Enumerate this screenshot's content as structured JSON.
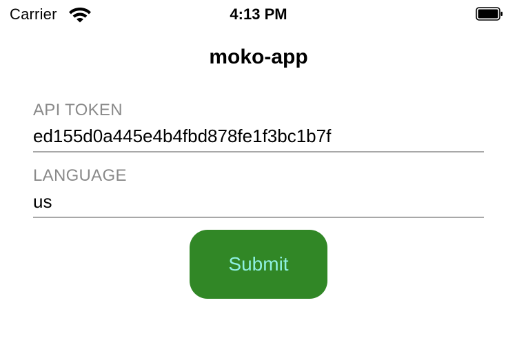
{
  "status_bar": {
    "carrier": "Carrier",
    "time": "4:13 PM",
    "wifi_icon": "wifi-icon",
    "battery_icon": "battery-icon"
  },
  "nav": {
    "title": "moko-app"
  },
  "form": {
    "api_token": {
      "label": "API TOKEN",
      "value": "ed155d0a445e4b4fbd878fe1f3bc1b7f"
    },
    "language": {
      "label": "LANGUAGE",
      "value": "us"
    },
    "submit_label": "Submit"
  },
  "colors": {
    "button_background": "#318726",
    "button_text": "#8ff0e2",
    "label_text": "#8a8a8a",
    "underline": "#a8a8a8"
  }
}
